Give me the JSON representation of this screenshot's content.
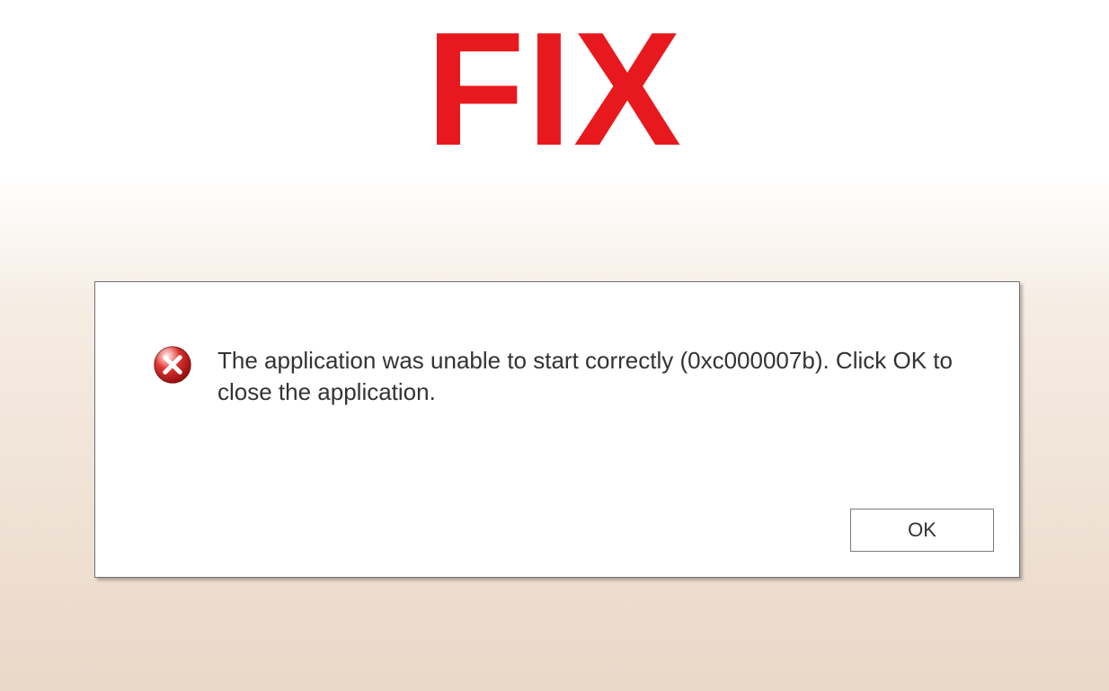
{
  "headline": "FIX",
  "dialog": {
    "message": "The application was unable to start correctly (0xc000007b). Click OK to close the application.",
    "ok_label": "OK"
  }
}
